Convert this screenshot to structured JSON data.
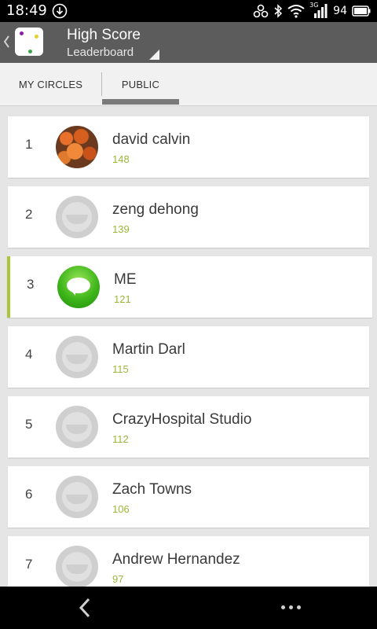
{
  "status_bar": {
    "time": "18:49",
    "battery": "94",
    "signal_label": "3G",
    "icons": [
      "download-icon",
      "link-icon",
      "bluetooth-icon",
      "wifi-icon",
      "signal-icon",
      "battery-icon"
    ]
  },
  "action_bar": {
    "title": "High Score",
    "subtitle": "Leaderboard",
    "background": "#5c5c5c"
  },
  "tabs": [
    {
      "label": "MY CIRCLES",
      "selected": false
    },
    {
      "label": "PUBLIC",
      "selected": true
    }
  ],
  "leaderboard": [
    {
      "rank": "1",
      "name": "david calvin",
      "score": "148",
      "avatar": "photo-avatar"
    },
    {
      "rank": "2",
      "name": "zeng dehong",
      "score": "139",
      "avatar": "default-avatar"
    },
    {
      "rank": "3",
      "name": "ME",
      "score": "121",
      "avatar": "messages-avatar",
      "highlight": true
    },
    {
      "rank": "4",
      "name": "Martin Darl",
      "score": "115",
      "avatar": "default-avatar"
    },
    {
      "rank": "5",
      "name": "CrazyHospital Studio",
      "score": "112",
      "avatar": "default-avatar"
    },
    {
      "rank": "6",
      "name": "Zach Towns",
      "score": "106",
      "avatar": "default-avatar"
    },
    {
      "rank": "7",
      "name": "Andrew Hernandez",
      "score": "97",
      "avatar": "default-avatar"
    }
  ],
  "colors": {
    "accent": "#9ab73a",
    "highlight_bar": "#a9c53a"
  },
  "nav_bar": {
    "icons": [
      "back-icon",
      "more-icon"
    ]
  }
}
